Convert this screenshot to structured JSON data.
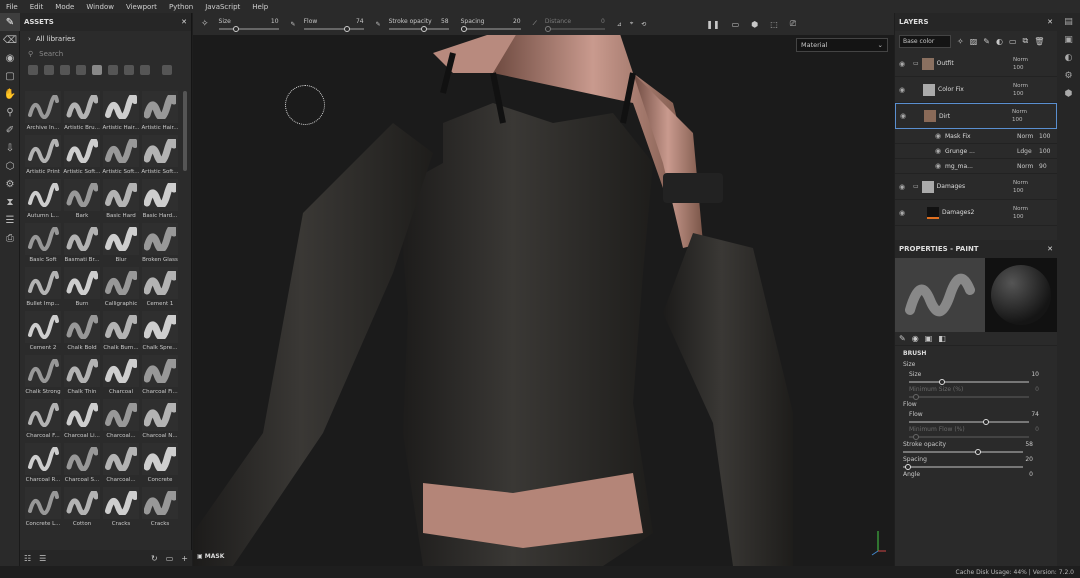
{
  "menu": [
    "File",
    "Edit",
    "Mode",
    "Window",
    "Viewport",
    "Python",
    "JavaScript",
    "Help"
  ],
  "toolbar": {
    "size_label": "Size",
    "size_value": "10",
    "flow_label": "Flow",
    "flow_value": "74",
    "opacity_label": "Stroke opacity",
    "opacity_value": "58",
    "spacing_label": "Spacing",
    "spacing_value": "20",
    "distance_label": "Distance",
    "distance_value": "0"
  },
  "assets": {
    "title": "ASSETS",
    "library": "All libraries",
    "search_placeholder": "Search",
    "items": [
      "Archive In...",
      "Artistic Bru...",
      "Artistic Hair...",
      "Artistic Hair...",
      "Artistic Print",
      "Artistic Soft...",
      "Artistic Soft...",
      "Artistic Soft...",
      "Autumn L...",
      "Bark",
      "Basic Hard",
      "Basic Hard...",
      "Basic Soft",
      "Basmati Br...",
      "Blur",
      "Broken Glass",
      "Bullet Imp...",
      "Burn",
      "Calligraphic",
      "Cement 1",
      "Cement 2",
      "Chalk Bold",
      "Chalk Burn...",
      "Chalk Spre...",
      "Chalk Strong",
      "Chalk Thin",
      "Charcoal",
      "Charcoal Fi...",
      "Charcoal F...",
      "Charcoal Li...",
      "Charcoal...",
      "Charcoal N...",
      "Charcoal R...",
      "Charcoal S...",
      "Charcoal...",
      "Concrete",
      "Concrete L...",
      "Cotton",
      "Cracks",
      "Cracks"
    ]
  },
  "viewport": {
    "material": "Material",
    "mask_label": "MASK"
  },
  "layers": {
    "title": "LAYERS",
    "channel": "Base color",
    "rows": [
      {
        "name": "Outfit",
        "blend": "Norm",
        "opacity": "100"
      },
      {
        "name": "Color Fix",
        "blend": "Norm",
        "opacity": "100"
      },
      {
        "name": "Dirt",
        "blend": "Norm",
        "opacity": "100"
      }
    ],
    "subrows": [
      {
        "name": "Mask Fix",
        "blend": "Norm",
        "opacity": "100"
      },
      {
        "name": "Grunge ...",
        "blend": "Ldge",
        "opacity": "100"
      },
      {
        "name": "mg_ma...",
        "blend": "Norm",
        "opacity": "90"
      }
    ],
    "rows2": [
      {
        "name": "Damages",
        "blend": "Norm",
        "opacity": "100"
      },
      {
        "name": "Damages2",
        "blend": "Norm",
        "opacity": "100"
      }
    ]
  },
  "properties": {
    "title": "PROPERTIES - PAINT",
    "brush_section": "BRUSH",
    "size_group": "Size",
    "size_label": "Size",
    "size_value": "10",
    "min_size_label": "Minimum Size (%)",
    "min_size_value": "0",
    "flow_group": "Flow",
    "flow_label": "Flow",
    "flow_value": "74",
    "min_flow_label": "Minimum Flow (%)",
    "min_flow_value": "0",
    "opacity_label": "Stroke opacity",
    "opacity_value": "58",
    "spacing_label": "Spacing",
    "spacing_value": "20",
    "angle_label": "Angle",
    "angle_value": "0"
  },
  "status": {
    "cache": "Cache Disk Usage:",
    "cache_value": "44%",
    "version": "Version: 7.2.0"
  },
  "colors": {
    "accent": "#5a8fd0",
    "orange": "#e07020",
    "skin": "#c99a8e",
    "leather": "#2b2a28"
  }
}
